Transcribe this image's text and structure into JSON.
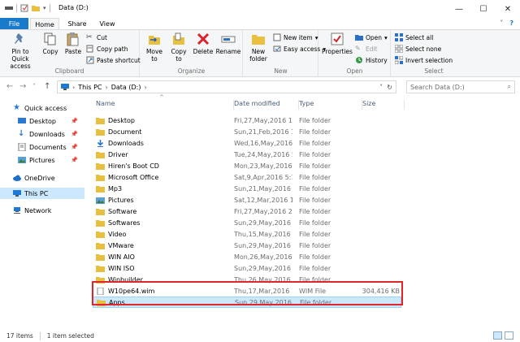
{
  "window": {
    "title": "Data (D:)",
    "minimize_icon": "minimize-icon",
    "maximize_icon": "maximize-icon",
    "close_icon": "close-icon"
  },
  "tabs": {
    "file": "File",
    "home": "Home",
    "share": "Share",
    "view": "View",
    "expand_icon": "chevron-down-icon",
    "help_icon": "help-icon"
  },
  "ribbon": {
    "clipboard": {
      "label": "Clipboard",
      "pin": "Pin to Quick access",
      "copy": "Copy",
      "paste": "Paste",
      "cut": "Cut",
      "copy_path": "Copy path",
      "paste_shortcut": "Paste shortcut"
    },
    "organize": {
      "label": "Organize",
      "move_to": "Move to",
      "copy_to": "Copy to",
      "delete": "Delete",
      "rename": "Rename"
    },
    "new": {
      "label": "New",
      "new_folder": "New folder",
      "new_item": "New item",
      "easy_access": "Easy access"
    },
    "open": {
      "label": "Open",
      "properties": "Properties",
      "open": "Open",
      "edit": "Edit",
      "history": "History"
    },
    "select": {
      "label": "Select",
      "select_all": "Select all",
      "select_none": "Select none",
      "invert": "Invert selection"
    }
  },
  "address": {
    "this_pc": "This PC",
    "drive": "Data (D:)",
    "search_placeholder": "Search Data (D:)"
  },
  "navpane": {
    "quick_access": "Quick access",
    "desktop": "Desktop",
    "downloads": "Downloads",
    "documents": "Documents",
    "pictures": "Pictures",
    "onedrive": "OneDrive",
    "this_pc": "This PC",
    "network": "Network"
  },
  "columns": {
    "name": "Name",
    "date": "Date modified",
    "type": "Type",
    "size": "Size"
  },
  "files": [
    {
      "name": "Desktop",
      "date": "Fri,27,May,2016 1...",
      "type": "File folder",
      "size": "",
      "icon": "folder-icon"
    },
    {
      "name": "Document",
      "date": "Sun,21,Feb,2016 1...",
      "type": "File folder",
      "size": "",
      "icon": "folder-icon"
    },
    {
      "name": "Downloads",
      "date": "Wed,16,May,2016 ...",
      "type": "File folder",
      "size": "",
      "icon": "download-folder-icon"
    },
    {
      "name": "Driver",
      "date": "Tue,24,May,2016 5:...",
      "type": "File folder",
      "size": "",
      "icon": "folder-icon"
    },
    {
      "name": "Hiren's Boot CD",
      "date": "Mon,23,May,2016 ...",
      "type": "File folder",
      "size": "",
      "icon": "folder-icon"
    },
    {
      "name": "Microsoft Office",
      "date": "Sat,9,Apr,2016 5:1...",
      "type": "File folder",
      "size": "",
      "icon": "folder-icon"
    },
    {
      "name": "Mp3",
      "date": "Sun,21,May,2016 5:...",
      "type": "File folder",
      "size": "",
      "icon": "folder-icon"
    },
    {
      "name": "Pictures",
      "date": "Sat,12,Mar,2016 1:...",
      "type": "File folder",
      "size": "",
      "icon": "pictures-folder-icon"
    },
    {
      "name": "Software",
      "date": "Fri,27,May,2016 2:...",
      "type": "File folder",
      "size": "",
      "icon": "folder-icon"
    },
    {
      "name": "Softwares",
      "date": "Sun,29,May,2016 2...",
      "type": "File folder",
      "size": "",
      "icon": "folder-icon"
    },
    {
      "name": "Video",
      "date": "Thu,15,May,2016 5:...",
      "type": "File folder",
      "size": "",
      "icon": "folder-icon"
    },
    {
      "name": "VMware",
      "date": "Sun,29,May,2016 2...",
      "type": "File folder",
      "size": "",
      "icon": "folder-icon"
    },
    {
      "name": "WIN AIO",
      "date": "Mon,26,May,2016 ...",
      "type": "File folder",
      "size": "",
      "icon": "folder-icon"
    },
    {
      "name": "WIN ISO",
      "date": "Sun,29,May,2016 2...",
      "type": "File folder",
      "size": "",
      "icon": "folder-icon"
    },
    {
      "name": "Winbuilder",
      "date": "Thu,26,May,2016 2...",
      "type": "File folder",
      "size": "",
      "icon": "folder-icon"
    },
    {
      "name": "W10pe64.wim",
      "date": "Thu,17,Mar,2016 1...",
      "type": "WIM File",
      "size": "304,416 KB",
      "icon": "file-icon"
    },
    {
      "name": "Apps",
      "date": "Sun,29,May,2016 3...",
      "type": "File folder",
      "size": "",
      "icon": "folder-icon"
    }
  ],
  "status": {
    "count": "17 items",
    "selected": "1 item selected"
  },
  "colors": {
    "accent": "#1979ca",
    "selection": "#cce8ff",
    "folder": "#e8bf3f",
    "highlight": "#e0262a"
  }
}
